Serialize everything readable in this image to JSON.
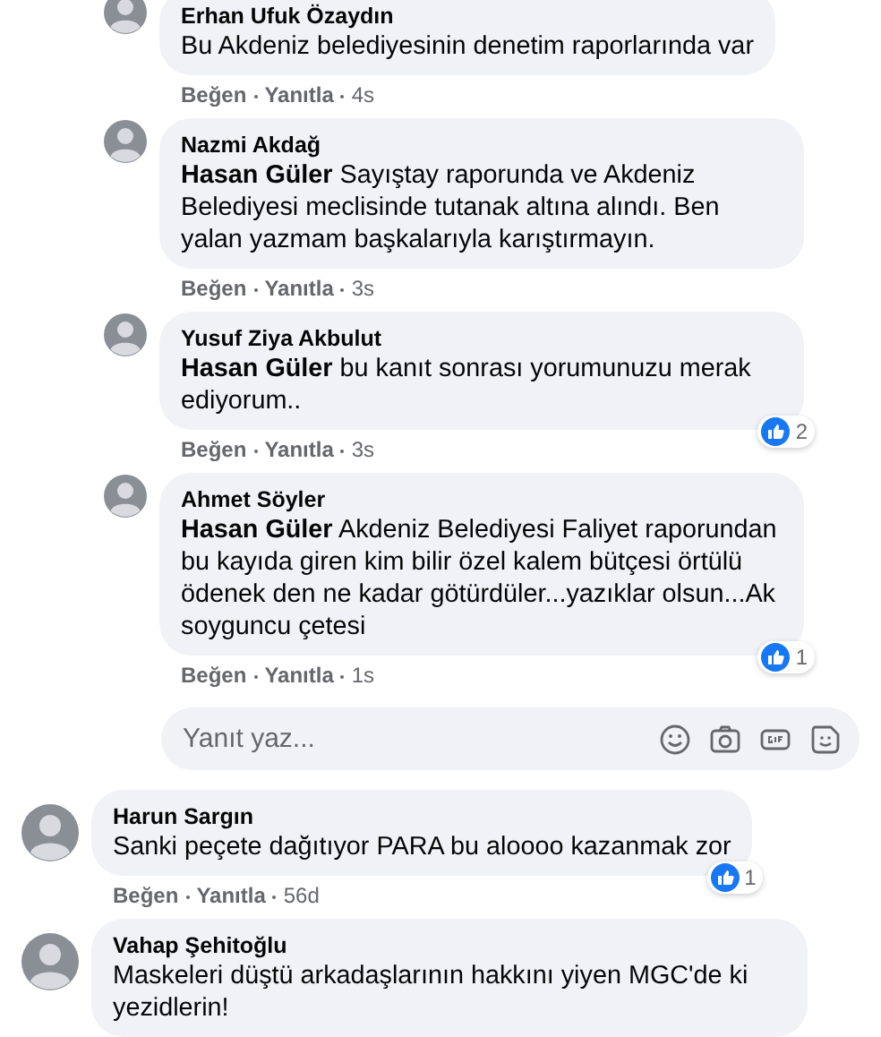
{
  "replies": [
    {
      "author": "Erhan Ufuk Özaydın",
      "text": "Bu Akdeniz belediyesinin denetim raporlarında var",
      "actions": [
        "Beğen",
        "Yanıtla",
        "4s"
      ]
    },
    {
      "author": "Nazmi Akdağ",
      "text": "**Hasan Güler** Sayıştay raporunda ve Akdeniz Belediyesi meclisinde tutanak altına alındı. Ben yalan yazmam başkalarıyla karıştırmayın.",
      "actions": [
        "Beğen",
        "Yanıtla",
        "3s"
      ]
    },
    {
      "author": "Yusuf Ziya Akbulut",
      "text": "**Hasan Güler** bu kanıt sonrası yorumunuzu merak ediyorum..",
      "actions": [
        "Beğen",
        "Yanıtla",
        "3s"
      ],
      "likes": "2"
    },
    {
      "author": "Ahmet Söyler",
      "text": "**Hasan Güler** Akdeniz Belediyesi Faliyet raporundan bu kayıda giren kim bilir özel kalem bütçesi örtülü ödenek den ne kadar götürdüler...yazıklar olsun...Ak soyguncu çetesi",
      "actions": [
        "Beğen",
        "Yanıtla",
        "1s"
      ],
      "likes": "1"
    }
  ],
  "reply_box": {
    "placeholder": "Yanıt yaz..."
  },
  "comments": [
    {
      "author": "Harun Sargın",
      "text": "Sanki peçete dağıtıyor PARA bu aloooo kazanmak zor",
      "actions": [
        "Beğen",
        "Yanıtla",
        "56d"
      ],
      "likes": "1"
    },
    {
      "author": "Vahap Şehitoğlu",
      "text": "Maskeleri düştü arkadaşlarının hakkını yiyen MGC'de ki yezidlerin!"
    }
  ]
}
